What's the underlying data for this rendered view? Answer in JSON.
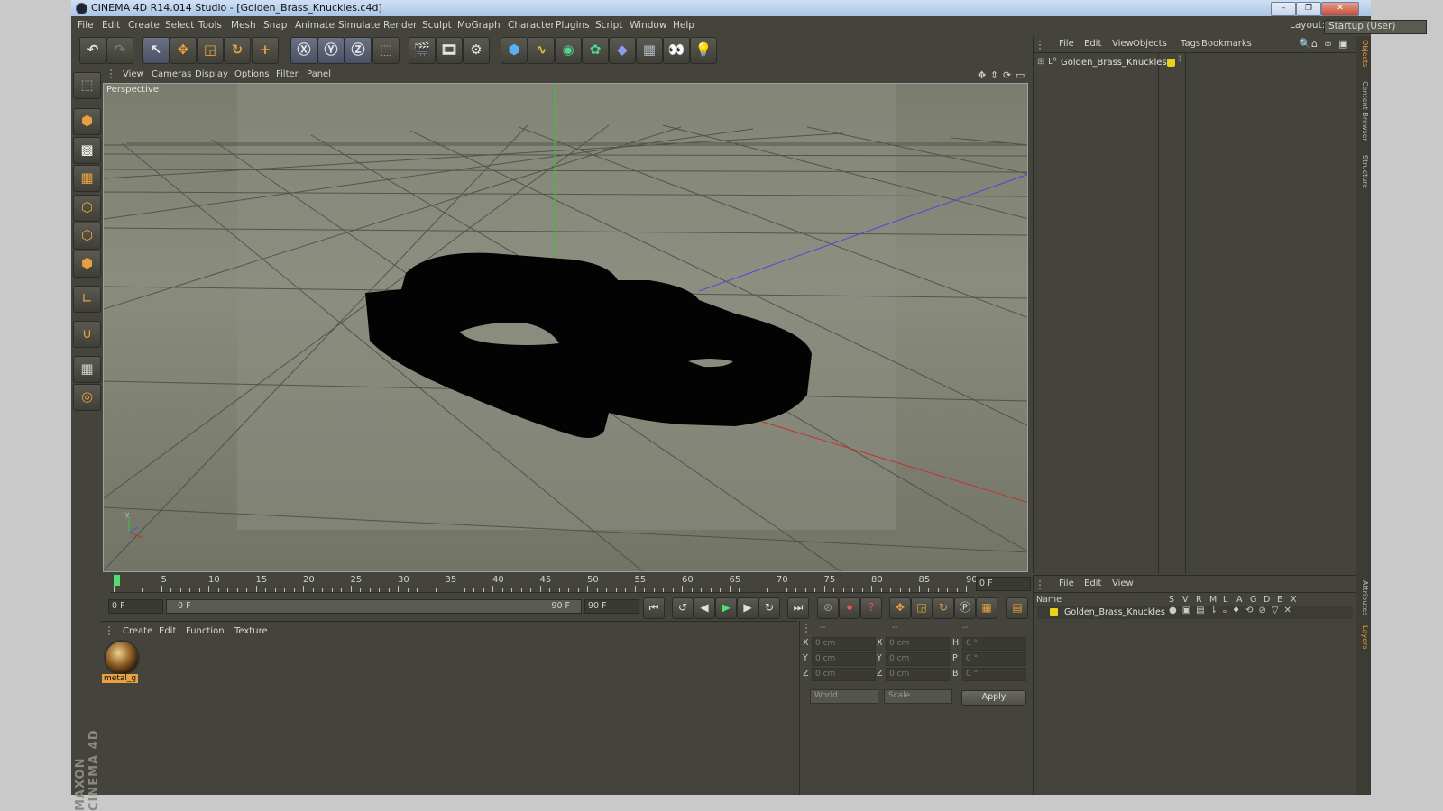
{
  "window": {
    "title": "CINEMA 4D R14.014 Studio - [Golden_Brass_Knuckles.c4d]",
    "controls": [
      "–",
      "❐",
      "✕"
    ]
  },
  "menu": {
    "items": [
      "File",
      "Edit",
      "Create",
      "Select",
      "Tools",
      "Mesh",
      "Snap",
      "Animate",
      "Simulate",
      "Render",
      "Sculpt",
      "MoGraph",
      "Character",
      "Plugins",
      "Script",
      "Window",
      "Help"
    ],
    "layout_label": "Layout:",
    "layout_value": "Startup (User)"
  },
  "viewport": {
    "menu": [
      "View",
      "Cameras",
      "Display",
      "Options",
      "Filter",
      "Panel"
    ],
    "label": "Perspective"
  },
  "timeline": {
    "ticks": [
      "0",
      "5",
      "10",
      "15",
      "20",
      "25",
      "30",
      "35",
      "40",
      "45",
      "50",
      "55",
      "60",
      "65",
      "70",
      "75",
      "80",
      "85",
      "90"
    ],
    "current_frame": "0 F",
    "start_field": "0 F",
    "range_start": "0 F",
    "range_end": "90 F",
    "end_field": "90 F"
  },
  "materials": {
    "menu": [
      "Create",
      "Edit",
      "Function",
      "Texture"
    ],
    "items": [
      {
        "name": "metal_g"
      }
    ]
  },
  "coordinates": {
    "headers": [
      "--",
      "--",
      "--"
    ],
    "rows": [
      {
        "a": "X",
        "av": "0 cm",
        "b": "X",
        "bv": "0 cm",
        "c": "H",
        "cv": "0 °"
      },
      {
        "a": "Y",
        "av": "0 cm",
        "b": "Y",
        "bv": "0 cm",
        "c": "P",
        "cv": "0 °"
      },
      {
        "a": "Z",
        "av": "0 cm",
        "b": "Z",
        "bv": "0 cm",
        "c": "B",
        "cv": "0 °"
      }
    ],
    "mode": "World",
    "scale": "Scale",
    "apply": "Apply"
  },
  "object_manager": {
    "menu": [
      "File",
      "Edit",
      "View",
      "Objects",
      "Tags",
      "Bookmarks"
    ],
    "objects": [
      {
        "name": "Golden_Brass_Knuckles",
        "color": "#e8d21a"
      }
    ]
  },
  "layer_manager": {
    "menu": [
      "File",
      "Edit",
      "View"
    ],
    "name_header": "Name",
    "flags": [
      "S",
      "V",
      "R",
      "M",
      "L",
      "A",
      "G",
      "D",
      "E",
      "X"
    ],
    "layers": [
      {
        "name": "Golden_Brass_Knuckles",
        "color": "#e8d21a"
      }
    ]
  },
  "side_tabs": [
    "Objects",
    "Content Browser",
    "Structure",
    "Attributes",
    "Layers"
  ],
  "brand": "MAXON CINEMA 4D",
  "colors": {
    "accent_orange": "#e8a040",
    "object_yellow": "#e8d21a",
    "panel_bg": "#44443c",
    "viewport_bg": "#6e6f62"
  }
}
